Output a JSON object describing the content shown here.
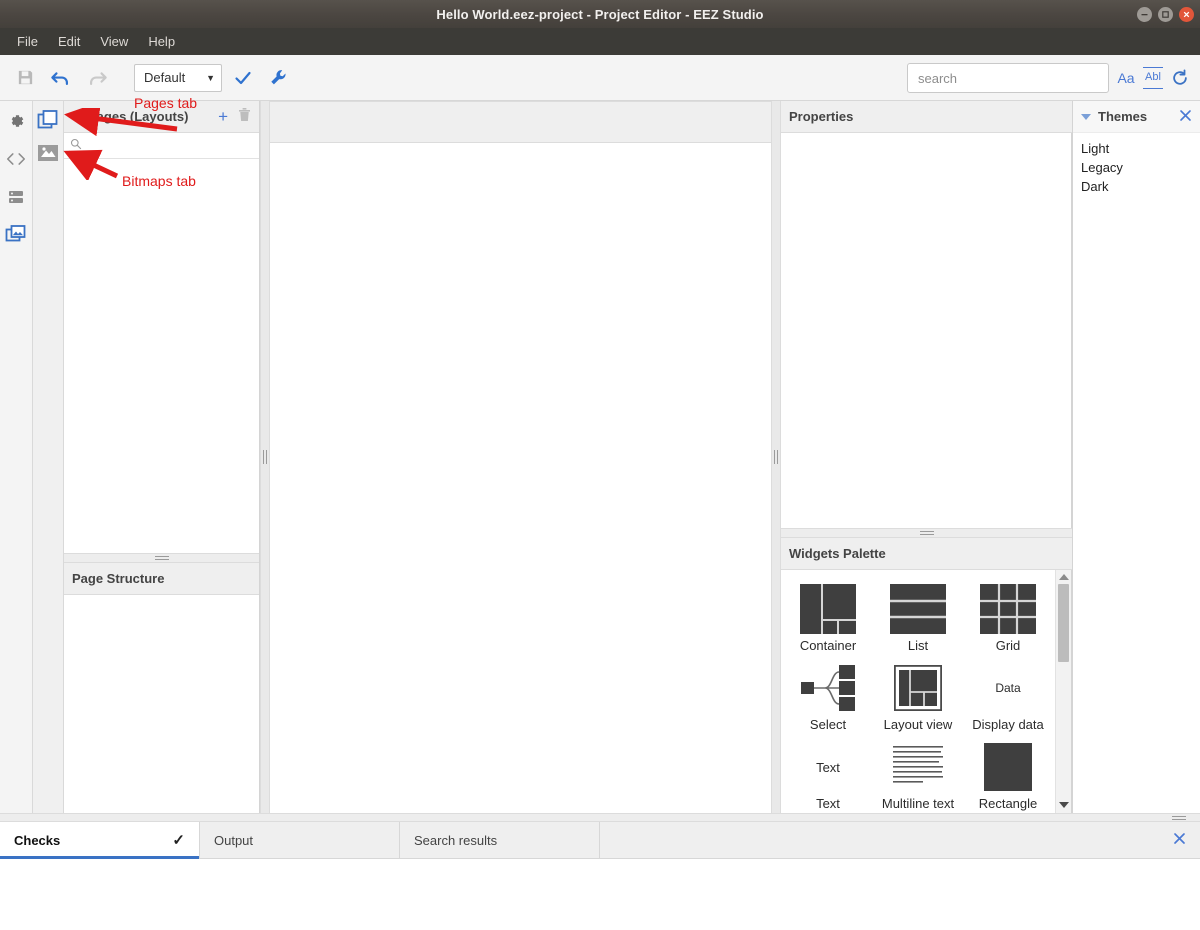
{
  "window": {
    "title": "Hello World.eez-project - Project Editor - EEZ Studio",
    "minimize": "–",
    "maximize": "□",
    "close": "×"
  },
  "menubar": {
    "items": [
      {
        "label": "File"
      },
      {
        "label": "Edit"
      },
      {
        "label": "View"
      },
      {
        "label": "Help"
      }
    ]
  },
  "toolbar": {
    "save_icon": "save-icon",
    "undo_icon": "undo-icon",
    "redo_icon": "redo-icon",
    "config_dropdown": {
      "value": "Default",
      "caret": "▼"
    },
    "check_icon": "checkmark-icon",
    "wrench_icon": "wrench-icon",
    "search": {
      "value": "",
      "placeholder": "search"
    },
    "match_case_label": "Aa",
    "whole_word_label": "Abl",
    "refresh_icon": "refresh-icon"
  },
  "rail": {
    "items": [
      {
        "name": "settings-icon"
      },
      {
        "name": "code-icon"
      },
      {
        "name": "stack-icon"
      },
      {
        "name": "images-icon"
      }
    ]
  },
  "tabstrip": {
    "items": [
      {
        "name": "pages-tab-icon"
      },
      {
        "name": "bitmaps-tab-icon"
      }
    ]
  },
  "pages_panel": {
    "title": "Pages (Layouts)",
    "caret": "▼",
    "add_label": "+",
    "delete_icon": "trash-icon",
    "filter": {
      "value": "",
      "placeholder": ""
    },
    "search_icon": "search-icon"
  },
  "page_structure_panel": {
    "title": "Page Structure"
  },
  "properties_panel": {
    "title": "Properties"
  },
  "widgets_palette": {
    "title": "Widgets Palette",
    "items": [
      {
        "label": "Container",
        "icon": "container-icon"
      },
      {
        "label": "List",
        "icon": "list-icon"
      },
      {
        "label": "Grid",
        "icon": "grid-icon"
      },
      {
        "label": "Select",
        "icon": "select-icon"
      },
      {
        "label": "Layout view",
        "icon": "layout-view-icon"
      },
      {
        "label": "Display data",
        "icon": "display-data-icon",
        "glyph": "Data"
      },
      {
        "label": "Text",
        "icon": "text-icon",
        "glyph": "Text"
      },
      {
        "label": "Multiline text",
        "icon": "multiline-text-icon"
      },
      {
        "label": "Rectangle",
        "icon": "rectangle-icon"
      }
    ],
    "scroll_up": "▲",
    "scroll_down": "▼"
  },
  "themes_panel": {
    "title": "Themes",
    "caret": "▼",
    "close": "×",
    "items": [
      {
        "label": "Light"
      },
      {
        "label": "Legacy"
      },
      {
        "label": "Dark"
      }
    ]
  },
  "bottom_tabs": {
    "items": [
      {
        "label": "Checks",
        "active": true,
        "check": "✓"
      },
      {
        "label": "Output",
        "active": false
      },
      {
        "label": "Search results",
        "active": false
      }
    ],
    "close": "×"
  },
  "annotations": [
    {
      "text": "Pages tab",
      "color": "#e01b1b"
    },
    {
      "text": "Bitmaps tab",
      "color": "#e01b1b"
    }
  ],
  "colors": {
    "titlebar": "#4b4641",
    "menubar": "#3c3b37",
    "accent_blue": "#4a79d4",
    "tab_underline": "#3a72c4",
    "annotation_red": "#e01b1b",
    "close_button": "#e2563a"
  }
}
